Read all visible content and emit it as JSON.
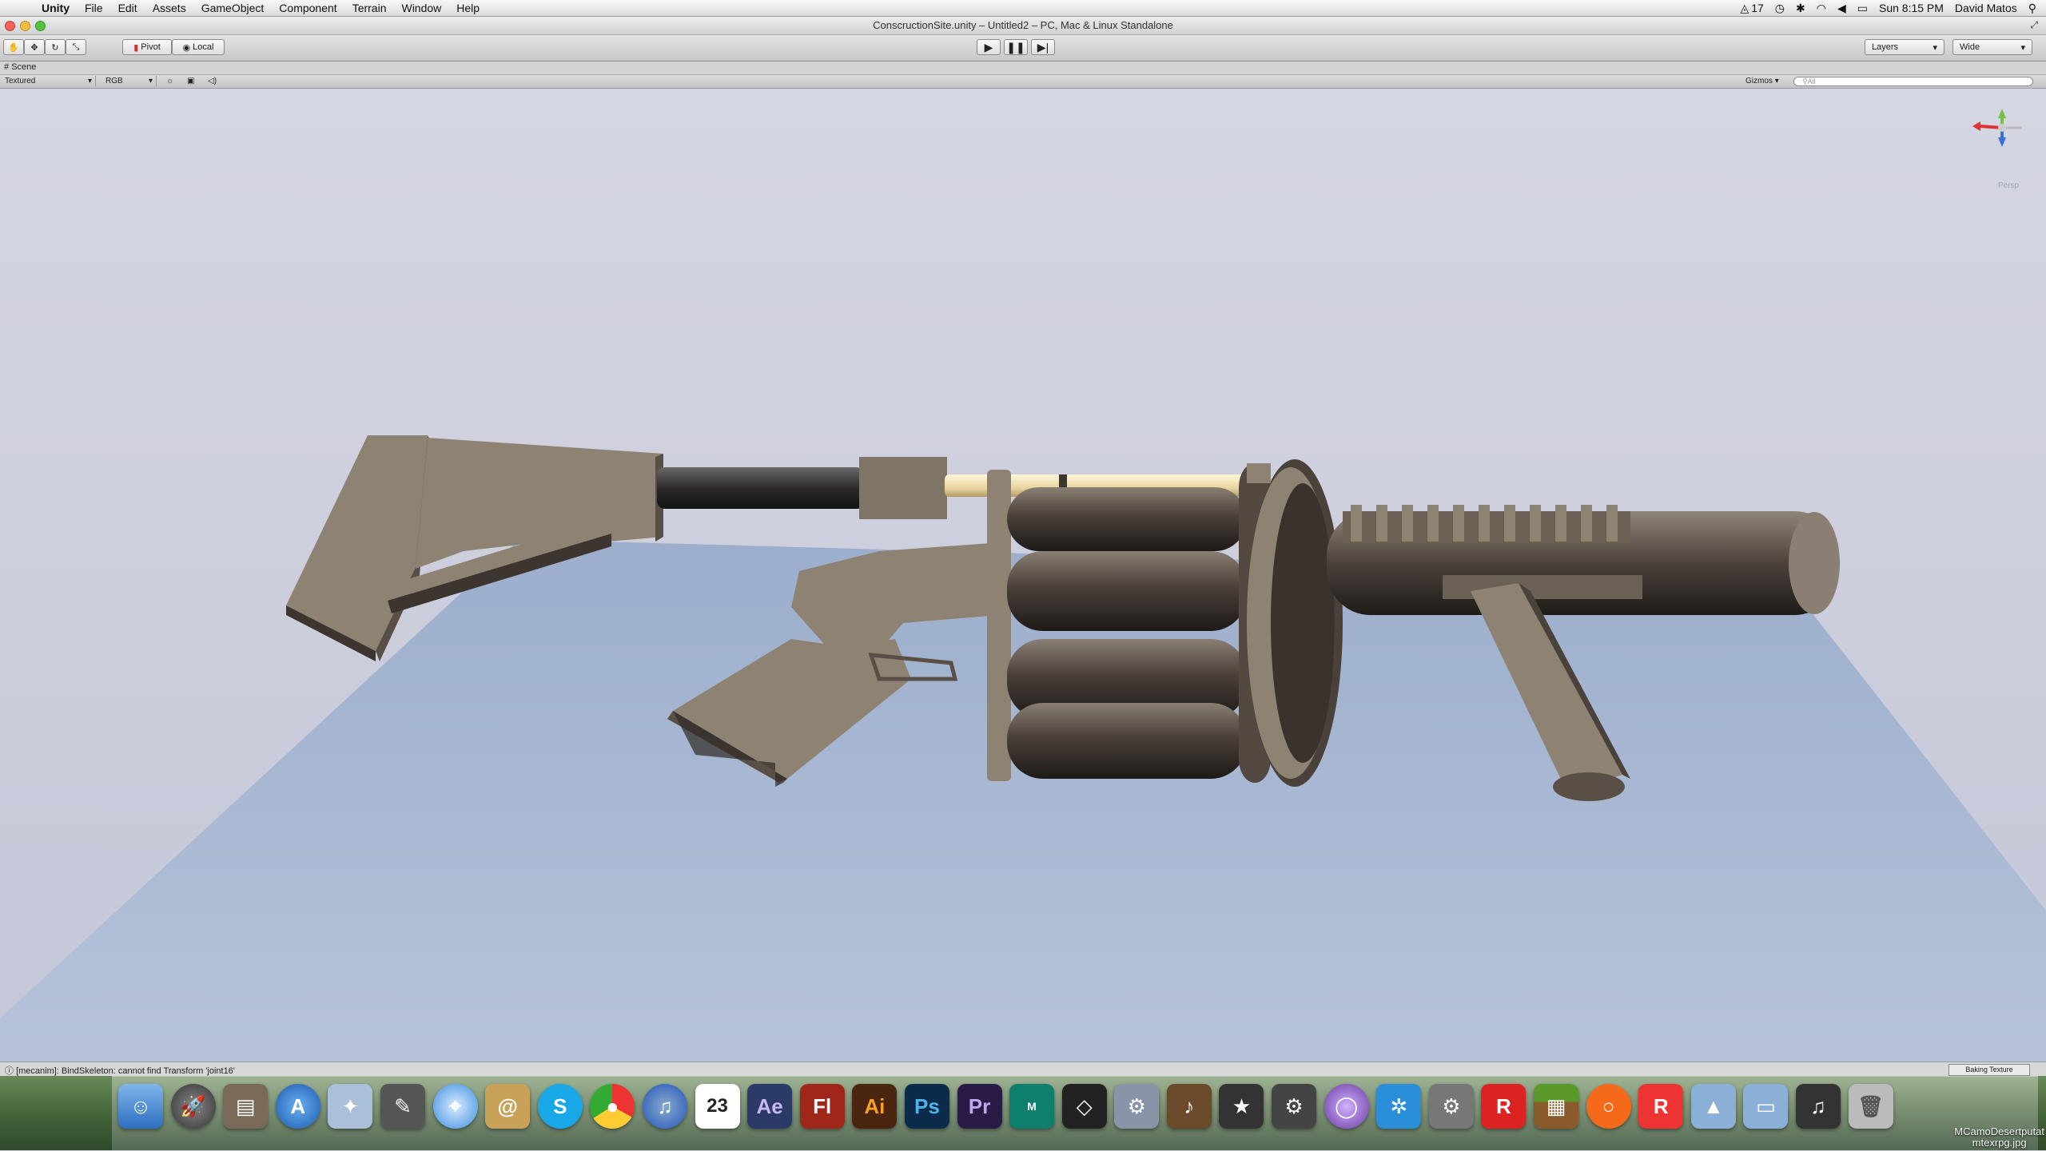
{
  "menubar": {
    "app_name": "Unity",
    "items": [
      "File",
      "Edit",
      "Assets",
      "GameObject",
      "Component",
      "Terrain",
      "Window",
      "Help"
    ],
    "status": {
      "adobe_count": "17",
      "clock": "Sun 8:15 PM",
      "user": "David Matos"
    }
  },
  "window": {
    "title": "ConscructionSite.unity – Untitled2 – PC, Mac & Linux Standalone"
  },
  "toolbar": {
    "pivot_label": "Pivot",
    "local_label": "Local",
    "layers_label": "Layers",
    "layout_label": "Wide"
  },
  "scene_tab": {
    "label": "Scene"
  },
  "scene_options": {
    "render_mode": "Textured",
    "color_mode": "RGB",
    "gizmos_label": "Gizmos",
    "search_placeholder": "All",
    "persp_label": "Persp"
  },
  "statusbar": {
    "message": "[mecanim]: BindSkeleton: cannot find Transform 'joint16'",
    "task": "Baking Texture"
  },
  "dock": {
    "apps": [
      "Finder",
      "Launchpad",
      "Photo Booth",
      "App Store",
      "Preview",
      "Pencil",
      "Safari",
      "Contacts",
      "Skype",
      "Chrome",
      "iTunes",
      "iCal",
      "After Effects",
      "Flash",
      "Illustrator",
      "Photoshop",
      "Premiere",
      "Maya",
      "Unity",
      "Preferences",
      "GarageBand",
      "iMovie",
      "Steam",
      "Sphere",
      "Box",
      "System Prefs",
      "Roblox",
      "Minecraft",
      "Origin",
      "Roblox Studio",
      "Applications",
      "Documents",
      "Music",
      "Trash"
    ],
    "calendar_day": "23",
    "file_label": "MCamoDesertputat\nmtexrpg.jpg"
  },
  "colors": {
    "gun_body": "#8e8273",
    "gun_dark": "#3d3530",
    "barrel_tan": "#f3e3b5",
    "floor": "#a6b8d4"
  }
}
